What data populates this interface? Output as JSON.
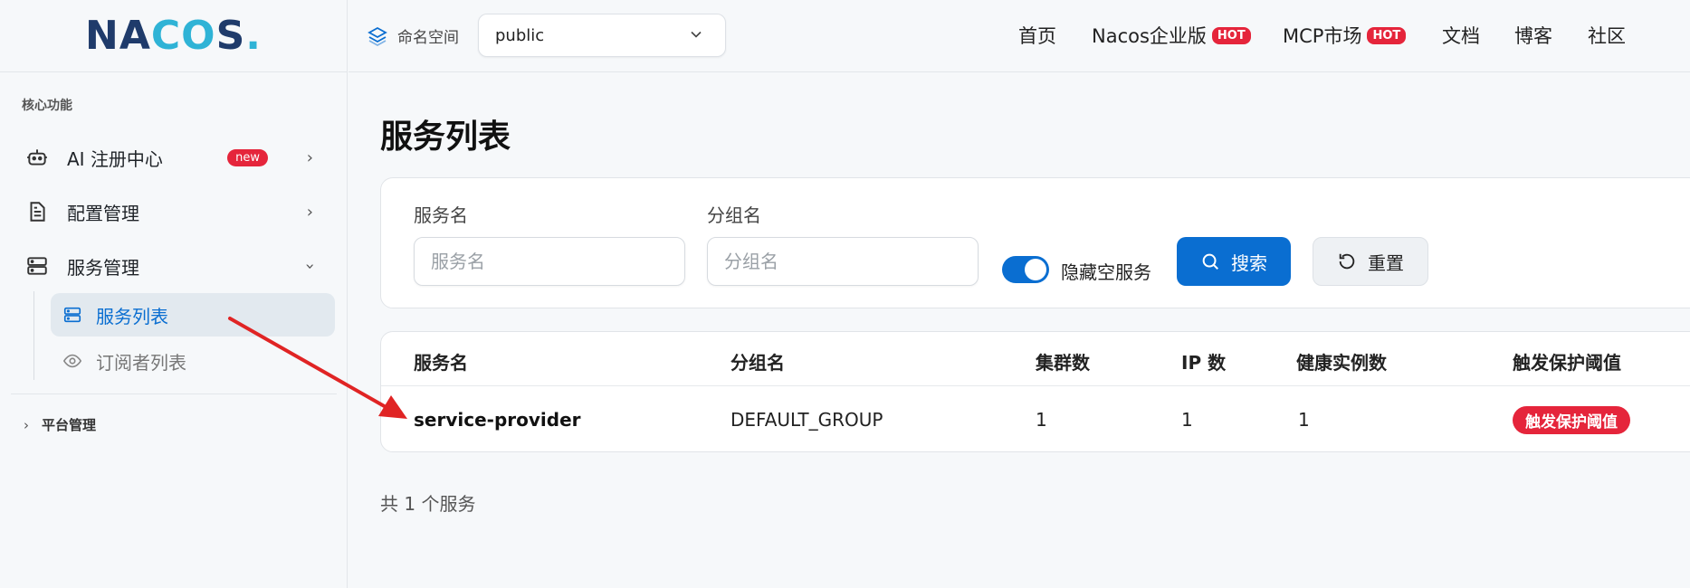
{
  "logo": {
    "text_n": "N",
    "text_a": "A",
    "text_c": "C",
    "text_o": "O",
    "text_s": "S",
    "dot": "."
  },
  "sidebar": {
    "section_label": "核心功能",
    "items": [
      {
        "label": "AI 注册中心",
        "badge": "new",
        "icon": "robot-icon"
      },
      {
        "label": "配置管理",
        "icon": "document-icon"
      },
      {
        "label": "服务管理",
        "icon": "server-icon"
      }
    ],
    "sub_items": [
      {
        "label": "服务列表",
        "icon": "server-icon",
        "active": true
      },
      {
        "label": "订阅者列表",
        "icon": "eye-icon",
        "active": false
      }
    ],
    "platform_label": "平台管理"
  },
  "topbar": {
    "namespace_label": "命名空间",
    "namespace_value": "public",
    "nav": [
      {
        "label": "首页"
      },
      {
        "label": "Nacos企业版",
        "badge": "HOT"
      },
      {
        "label": "MCP市场",
        "badge": "HOT"
      },
      {
        "label": "文档"
      },
      {
        "label": "博客"
      },
      {
        "label": "社区"
      }
    ]
  },
  "page": {
    "title": "服务列表",
    "filters": {
      "service_label": "服务名",
      "service_placeholder": "服务名",
      "group_label": "分组名",
      "group_placeholder": "分组名",
      "hide_empty_label": "隐藏空服务",
      "hide_empty_on": true,
      "search_label": "搜索",
      "reset_label": "重置"
    },
    "table": {
      "headers": [
        "服务名",
        "分组名",
        "集群数",
        "IP 数",
        "健康实例数",
        "触发保护阈值"
      ],
      "rows": [
        {
          "service": "service-provider",
          "group": "DEFAULT_GROUP",
          "clusters": "1",
          "ips": "1",
          "healthy": "1",
          "protect": "触发保护阈值"
        }
      ]
    },
    "total": "共 1 个服务"
  },
  "colors": {
    "primary": "#0a6ed1",
    "danger": "#e5253b",
    "annotation": "#e02424"
  }
}
